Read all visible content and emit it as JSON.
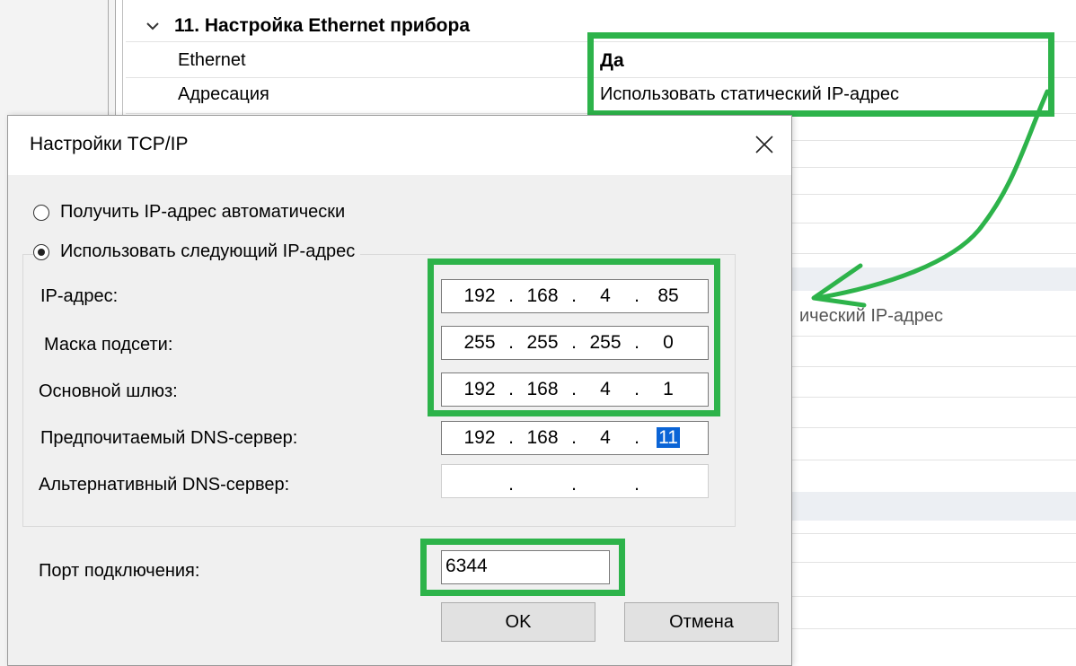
{
  "background": {
    "section_title": "11. Настройка Ethernet прибора",
    "rows": [
      {
        "name": "Ethernet",
        "value": "Да"
      },
      {
        "name": "Адресация",
        "value": "Использовать статический IP-адрес"
      }
    ],
    "partial_value": "ический IP-адрес"
  },
  "dialog": {
    "title": "Настройки TCP/IP",
    "close_symbol": "✕",
    "radio_auto": "Получить IP-адрес автоматически",
    "radio_manual": "Использовать следующий IP-адрес",
    "selected_mode": "manual",
    "fields": {
      "ip": {
        "label": "IP-адрес:",
        "octets": [
          "192",
          "168",
          "4",
          "85"
        ]
      },
      "mask": {
        "label": "Маска подсети:",
        "octets": [
          "255",
          "255",
          "255",
          "0"
        ]
      },
      "gateway": {
        "label": "Основной шлюз:",
        "octets": [
          "192",
          "168",
          "4",
          "1"
        ]
      },
      "dns_pref": {
        "label": "Предпочитаемый DNS-сервер:",
        "octets": [
          "192",
          "168",
          "4",
          "11"
        ]
      },
      "dns_alt": {
        "label": "Альтернативный DNS-сервер:",
        "octets": [
          "",
          "",
          "",
          ""
        ]
      }
    },
    "port": {
      "label": "Порт подключения:",
      "value": "6344"
    },
    "ok_label": "OK",
    "cancel_label": "Отмена"
  },
  "colors": {
    "highlight": "#2db34a",
    "selection": "#0a64d6"
  },
  "icons": [
    "chevron-down-icon",
    "close-icon",
    "arrow-annotation"
  ]
}
